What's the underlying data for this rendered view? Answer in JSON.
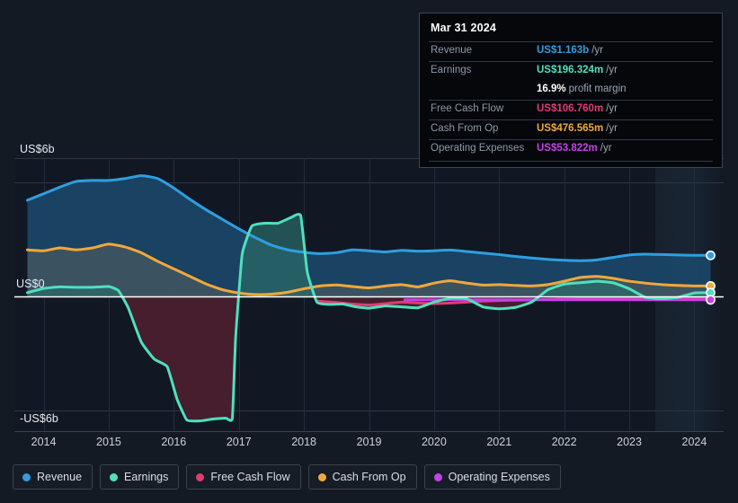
{
  "background": "#131a24",
  "axes": {
    "y_labels": [
      {
        "text": "US$6b",
        "value": 6
      },
      {
        "text": "US$0",
        "value": 0
      },
      {
        "text": "-US$6b",
        "value": -6
      }
    ],
    "x_labels": [
      "2014",
      "2015",
      "2016",
      "2017",
      "2018",
      "2019",
      "2020",
      "2021",
      "2022",
      "2023",
      "2024"
    ]
  },
  "tooltip": {
    "date": "Mar 31 2024",
    "rows": [
      {
        "key": "Revenue",
        "value": "US$1.163b",
        "unit": "/yr",
        "color": "#2e9fe0"
      },
      {
        "key": "Earnings",
        "value": "US$196.324m",
        "unit": "/yr",
        "color": "#4fe0bd"
      },
      {
        "key": "",
        "value": "16.9%",
        "unit": "profit margin",
        "color": "#ffffff"
      },
      {
        "key": "Free Cash Flow",
        "value": "US$106.760m",
        "unit": "/yr",
        "color": "#e23a72"
      },
      {
        "key": "Cash From Op",
        "value": "US$476.565m",
        "unit": "/yr",
        "color": "#f0a83c"
      },
      {
        "key": "Operating Expenses",
        "value": "US$53.822m",
        "unit": "/yr",
        "color": "#c542e8"
      }
    ]
  },
  "legend": {
    "items": [
      {
        "label": "Revenue",
        "color": "#2e9fe0"
      },
      {
        "label": "Earnings",
        "color": "#4fe0bd"
      },
      {
        "label": "Free Cash Flow",
        "color": "#e23a72"
      },
      {
        "label": "Cash From Op",
        "color": "#f0a83c"
      },
      {
        "label": "Operating Expenses",
        "color": "#c542e8"
      }
    ]
  },
  "chart_data": {
    "type": "area",
    "title": "",
    "xlabel": "",
    "ylabel": "",
    "currency": "USD",
    "grid": true,
    "legend_position": "bottom",
    "xlim": [
      2013.55,
      2024.45
    ],
    "ylim": [
      -6.9,
      7.2
    ],
    "y_ticks": [
      6,
      0,
      -6
    ],
    "x_ticks": [
      2014,
      2015,
      2016,
      2017,
      2018,
      2019,
      2020,
      2021,
      2022,
      2023,
      2024
    ],
    "forecast_band_start": 2023.4,
    "zero_line": 0,
    "series": [
      {
        "name": "Revenue",
        "color": "#2e9fe0",
        "fill": "#1b4668",
        "x": [
          2013.75,
          2014.0,
          2014.25,
          2014.5,
          2014.75,
          2015.0,
          2015.25,
          2015.5,
          2015.75,
          2016.0,
          2016.25,
          2016.5,
          2016.75,
          2017.0,
          2017.25,
          2017.5,
          2017.75,
          2018.0,
          2018.25,
          2018.5,
          2018.75,
          2019.0,
          2019.25,
          2019.5,
          2019.75,
          2020.0,
          2020.25,
          2020.5,
          2020.75,
          2021.0,
          2021.25,
          2021.5,
          2021.75,
          2022.0,
          2022.25,
          2022.5,
          2022.75,
          2023.0,
          2023.25,
          2023.5,
          2023.75,
          2024.0,
          2024.25
        ],
        "y": [
          5.06,
          5.4,
          5.75,
          6.05,
          6.1,
          6.1,
          6.2,
          6.35,
          6.2,
          5.7,
          5.1,
          4.55,
          4.05,
          3.55,
          3.1,
          2.7,
          2.45,
          2.32,
          2.25,
          2.3,
          2.45,
          2.4,
          2.34,
          2.42,
          2.38,
          2.4,
          2.44,
          2.36,
          2.28,
          2.2,
          2.1,
          2.02,
          1.95,
          1.9,
          1.88,
          1.92,
          2.05,
          2.18,
          2.22,
          2.2,
          2.18,
          2.16,
          2.16
        ]
      },
      {
        "name": "Earnings",
        "color": "#4fe0bd",
        "fill_positive": "#2b6a68",
        "fill_negative": "#4b2030",
        "x": [
          2013.75,
          2014.0,
          2014.25,
          2014.5,
          2014.75,
          2015.0,
          2015.15,
          2015.3,
          2015.5,
          2015.7,
          2015.9,
          2016.05,
          2016.2,
          2016.4,
          2016.6,
          2016.8,
          2016.9,
          2016.95,
          2017.05,
          2017.2,
          2017.4,
          2017.6,
          2017.8,
          2017.95,
          2018.05,
          2018.2,
          2018.4,
          2018.6,
          2018.8,
          2019.0,
          2019.25,
          2019.5,
          2019.75,
          2020.0,
          2020.25,
          2020.5,
          2020.75,
          2021.0,
          2021.25,
          2021.5,
          2021.75,
          2022.0,
          2022.25,
          2022.5,
          2022.75,
          2023.0,
          2023.25,
          2023.5,
          2023.75,
          2024.0,
          2024.25
        ],
        "y": [
          0.2,
          0.42,
          0.5,
          0.48,
          0.48,
          0.52,
          0.3,
          -0.6,
          -2.4,
          -3.3,
          -3.7,
          -5.4,
          -6.5,
          -6.55,
          -6.45,
          -6.4,
          -6.4,
          -2.2,
          2.2,
          3.7,
          3.85,
          3.85,
          4.15,
          4.25,
          1.3,
          -0.3,
          -0.42,
          -0.4,
          -0.55,
          -0.62,
          -0.5,
          -0.55,
          -0.6,
          -0.3,
          -0.1,
          -0.12,
          -0.55,
          -0.65,
          -0.58,
          -0.3,
          0.35,
          0.65,
          0.72,
          0.8,
          0.72,
          0.4,
          -0.05,
          -0.12,
          -0.05,
          0.18,
          0.2
        ]
      },
      {
        "name": "Free Cash Flow",
        "color": "#e23a72",
        "x": [
          2018.2,
          2018.5,
          2018.75,
          2019.0,
          2019.25,
          2019.5,
          2019.75,
          2020.0,
          2020.25,
          2020.5,
          2020.75,
          2021.0,
          2021.25,
          2021.5,
          2021.75,
          2022.0,
          2022.25,
          2022.5,
          2022.75,
          2023.0,
          2023.25,
          2023.5,
          2023.75,
          2024.0,
          2024.25
        ],
        "y": [
          -0.25,
          -0.32,
          -0.4,
          -0.45,
          -0.38,
          -0.3,
          -0.34,
          -0.38,
          -0.35,
          -0.3,
          -0.25,
          -0.22,
          -0.2,
          -0.18,
          -0.16,
          -0.14,
          -0.12,
          -0.12,
          -0.12,
          -0.12,
          -0.12,
          -0.12,
          -0.12,
          -0.11,
          -0.11
        ]
      },
      {
        "name": "Cash From Op",
        "color": "#f0a83c",
        "x": [
          2013.75,
          2014.0,
          2014.25,
          2014.5,
          2014.75,
          2015.0,
          2015.25,
          2015.5,
          2015.75,
          2016.0,
          2016.25,
          2016.5,
          2016.75,
          2017.0,
          2017.25,
          2017.5,
          2017.75,
          2018.0,
          2018.25,
          2018.5,
          2018.75,
          2019.0,
          2019.25,
          2019.5,
          2019.75,
          2020.0,
          2020.25,
          2020.5,
          2020.75,
          2021.0,
          2021.25,
          2021.5,
          2021.75,
          2022.0,
          2022.25,
          2022.5,
          2022.75,
          2023.0,
          2023.25,
          2023.5,
          2023.75,
          2024.0,
          2024.25
        ],
        "y": [
          2.45,
          2.4,
          2.55,
          2.45,
          2.55,
          2.75,
          2.6,
          2.3,
          1.85,
          1.45,
          1.05,
          0.65,
          0.35,
          0.18,
          0.1,
          0.12,
          0.22,
          0.4,
          0.55,
          0.6,
          0.52,
          0.45,
          0.55,
          0.62,
          0.5,
          0.7,
          0.82,
          0.7,
          0.6,
          0.62,
          0.58,
          0.55,
          0.62,
          0.8,
          1.0,
          1.05,
          0.95,
          0.8,
          0.7,
          0.62,
          0.58,
          0.55,
          0.55
        ]
      },
      {
        "name": "Operating Expenses",
        "color": "#c542e8",
        "x": [
          2019.55,
          2019.75,
          2020.0,
          2020.25,
          2020.5,
          2020.75,
          2021.0,
          2021.25,
          2021.5,
          2021.75,
          2022.0,
          2022.25,
          2022.5,
          2022.75,
          2023.0,
          2023.25,
          2023.5,
          2023.75,
          2024.0,
          2024.25
        ],
        "y": [
          -0.18,
          -0.18,
          -0.18,
          -0.18,
          -0.18,
          -0.18,
          -0.18,
          -0.18,
          -0.18,
          -0.18,
          -0.18,
          -0.18,
          -0.18,
          -0.18,
          -0.18,
          -0.18,
          -0.18,
          -0.18,
          -0.18,
          -0.18
        ]
      }
    ],
    "endpoints": [
      {
        "name": "Revenue",
        "color": "#2e9fe0",
        "x": 2024.25,
        "y": 2.16
      },
      {
        "name": "Cash From Op",
        "color": "#f0a83c",
        "x": 2024.25,
        "y": 0.55
      },
      {
        "name": "Earnings",
        "color": "#4fe0bd",
        "x": 2024.25,
        "y": 0.2
      },
      {
        "name": "Operating Expenses",
        "color": "#c542e8",
        "x": 2024.25,
        "y": -0.18
      }
    ]
  }
}
